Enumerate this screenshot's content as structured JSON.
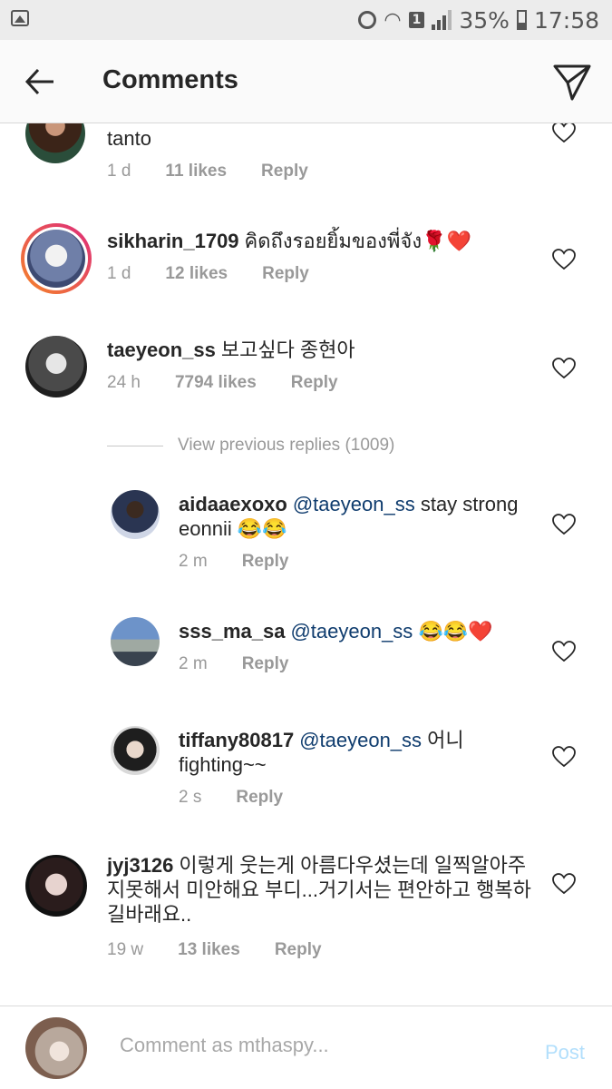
{
  "status_bar": {
    "battery": "35%",
    "time": "17:58",
    "sim_slot": "1",
    "icons": [
      "gallery-icon",
      "alarm-icon",
      "wifi-icon",
      "signal-icon",
      "battery-icon"
    ]
  },
  "header": {
    "title": "Comments",
    "back_icon": "arrow-left-icon",
    "send_icon": "paper-plane-icon"
  },
  "comments": [
    {
      "username": "",
      "text": "tanto",
      "time": "1 d",
      "likes": "11 likes",
      "reply": "Reply"
    },
    {
      "username": "sikharin_1709",
      "text": "คิดถึงรอยยิ้มของพี่จัง🌹❤️",
      "time": "1 d",
      "likes": "12 likes",
      "reply": "Reply"
    },
    {
      "username": "taeyeon_ss",
      "text": "보고싶다 종현아",
      "time": "24 h",
      "likes": "7794 likes",
      "reply": "Reply"
    },
    {
      "username": "jyj3126",
      "text": "이렇게 웃는게 아름다우셨는데 일찍알아주지못해서 미안해요 부디...거기서는 편안하고 행복하길바래요..",
      "time": "19 w",
      "likes": "13 likes",
      "reply": "Reply"
    }
  ],
  "view_previous": "View previous replies (1009)",
  "replies": [
    {
      "username": "aidaaexoxo",
      "mention": "@taeyeon_ss",
      "text": "stay strong eonnii 😂😂",
      "time": "2 m",
      "reply": "Reply"
    },
    {
      "username": "sss_ma_sa",
      "mention": "@taeyeon_ss",
      "text": "😂😂❤️",
      "time": "2 m",
      "reply": "Reply"
    },
    {
      "username": "tiffany80817",
      "mention": "@taeyeon_ss",
      "text": "어니 fighting~~",
      "time": "2 s",
      "reply": "Reply"
    }
  ],
  "composer": {
    "placeholder": "Comment as mthaspy...",
    "post_label": "Post"
  },
  "colors": {
    "mention": "#0f3c6e",
    "post_disabled": "#b2dffc",
    "meta_gray": "#999999",
    "heart_stroke": "#262626",
    "story_ring_start": "#f58529",
    "story_ring_end": "#dd2a7b"
  }
}
